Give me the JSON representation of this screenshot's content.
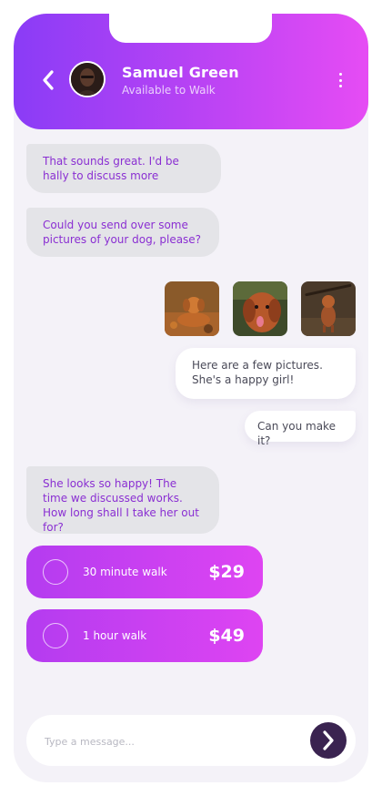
{
  "header": {
    "contact_name": "Samuel Green",
    "status": "Available to Walk",
    "back_icon": "chevron-left-icon",
    "more_icon": "vertical-dots-icon"
  },
  "messages": [
    {
      "direction": "incoming",
      "text": "That sounds great. I'd be hally to discuss more"
    },
    {
      "direction": "incoming",
      "text": "Could you send over some pictures of your dog, please?"
    },
    {
      "direction": "outgoing",
      "text": "Here are a few pictures. She's a happy girl!"
    },
    {
      "direction": "outgoing",
      "text": "Can you make it?"
    },
    {
      "direction": "incoming",
      "text": "She looks so happy! The time we discussed works. How long shall I take her out for?"
    }
  ],
  "photos": [
    {
      "subject": "dog lying on autumn leaves"
    },
    {
      "subject": "happy dog with tongue out"
    },
    {
      "subject": "dog carrying stick in forest"
    }
  ],
  "options": [
    {
      "label": "30 minute walk",
      "price": "$29"
    },
    {
      "label": "1 hour walk",
      "price": "$49"
    }
  ],
  "composer": {
    "placeholder": "Type a message...",
    "value": "",
    "send_icon": "chevron-right-icon"
  },
  "colors": {
    "accent_start": "#8a3cf6",
    "accent_end": "#e64cf4",
    "incoming_text": "#8a2fd2",
    "send_button": "#3a2350",
    "background": "#f4f2f8"
  }
}
